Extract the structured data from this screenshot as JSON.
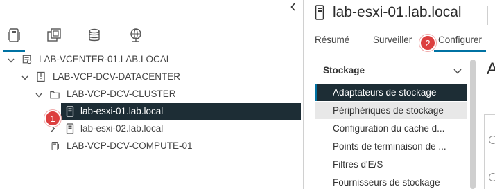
{
  "left_pane": {
    "collapse_icon": "chevron-left-icon",
    "view_tabs": [
      {
        "icon": "hosts-clusters-icon",
        "active": true
      },
      {
        "icon": "vms-templates-icon",
        "active": false
      },
      {
        "icon": "storage-icon",
        "active": false
      },
      {
        "icon": "networking-icon",
        "active": false
      }
    ],
    "tree": [
      {
        "label": "LAB-VCENTER-01.LAB.LOCAL",
        "icon": "vcenter-icon",
        "expanded": true
      },
      {
        "label": "LAB-VCP-DCV-DATACENTER",
        "icon": "datacenter-icon",
        "expanded": true
      },
      {
        "label": "LAB-VCP-DCV-CLUSTER",
        "icon": "folder-icon",
        "expanded": true
      },
      {
        "label": "lab-esxi-01.lab.local",
        "icon": "host-icon",
        "selected": true
      },
      {
        "label": "lab-esxi-02.lab.local",
        "icon": "host-icon",
        "collapsed": true
      },
      {
        "label": "LAB-VCP-DCV-COMPUTE-01",
        "icon": "compute-cluster-icon"
      }
    ]
  },
  "right_pane": {
    "title": "lab-esxi-01.lab.local",
    "title_icon": "host-icon",
    "tabs": [
      {
        "label": "Résumé",
        "active": false
      },
      {
        "label": "Surveiller",
        "active": false
      },
      {
        "label": "Configurer",
        "active": true
      }
    ],
    "nav_section": "Stockage",
    "nav_items": [
      {
        "label": "Adaptateurs de stockage",
        "state": "active"
      },
      {
        "label": "Périphériques de stockage",
        "state": "hover"
      },
      {
        "label": "Configuration du cache d...",
        "state": ""
      },
      {
        "label": "Points de terminaison de ...",
        "state": ""
      },
      {
        "label": "Filtres d'E/S",
        "state": ""
      },
      {
        "label": "Fournisseurs de stockage",
        "state": ""
      }
    ],
    "content_heading": "A"
  },
  "badges": [
    {
      "number": "1"
    },
    {
      "number": "2"
    }
  ],
  "colors": {
    "selection_bg": "#1d2d35",
    "accent": "#0072a3",
    "badge": "#dc3f3f"
  }
}
